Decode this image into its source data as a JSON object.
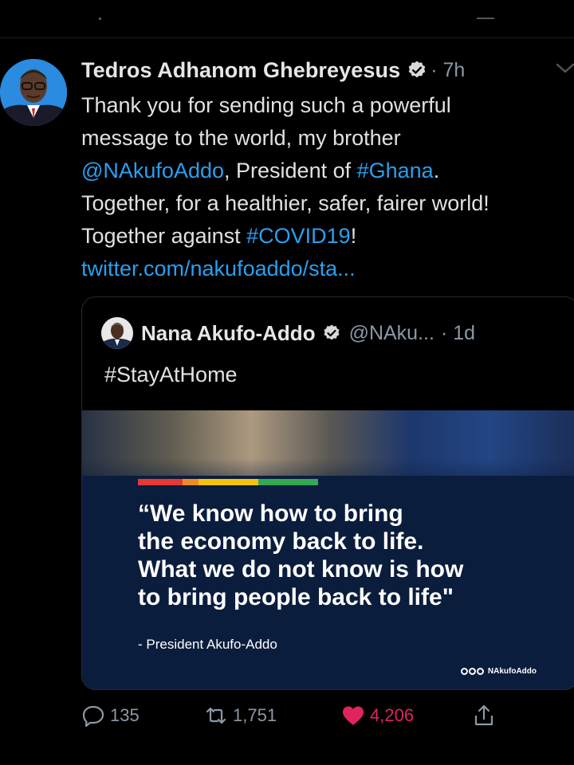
{
  "tweet": {
    "author": {
      "name": "Tedros Adhanom Ghebreyesus",
      "verified": true,
      "time": "· 7h",
      "avatar_icon": "profile-photo"
    },
    "body": {
      "line1": "Thank you for sending such a powerful",
      "line2": "message to the world, my brother",
      "mention": "@NAkufoAddo",
      "line3_rest": ", President of ",
      "hashtag_ghana": "#Ghana",
      "line3_end": ".",
      "line4": "Together, for a healthier, safer, fairer world!",
      "line5_start": "Together against ",
      "hashtag_covid": "#COVID19",
      "line5_end": "!",
      "url": "twitter.com/nakufoaddo/sta..."
    },
    "quoted": {
      "name": "Nana Akufo-Addo",
      "verified": true,
      "handle": "@NAku...",
      "time": "· 1d",
      "text": "#StayAtHome",
      "image": {
        "quote_line1": "“We know how to bring",
        "quote_line2": "the economy back to life.",
        "quote_line3": "What we do not know is how",
        "quote_line4": "to bring people back to life\"",
        "attribution": "- President Akufo-Addo",
        "watermark": "NAkufoAddo",
        "stripe_colors": [
          "#e53935",
          "#f4c20d",
          "#34a853"
        ]
      }
    },
    "actions": {
      "replies": "135",
      "retweets": "1,751",
      "likes": "4,206",
      "reply_icon": "reply-icon",
      "retweet_icon": "retweet-icon",
      "like_icon": "heart-icon",
      "share_icon": "share-icon"
    },
    "colors": {
      "link": "#2a9ff0",
      "like": "#e0245e",
      "muted": "#8b98a5",
      "background": "#000000"
    }
  }
}
